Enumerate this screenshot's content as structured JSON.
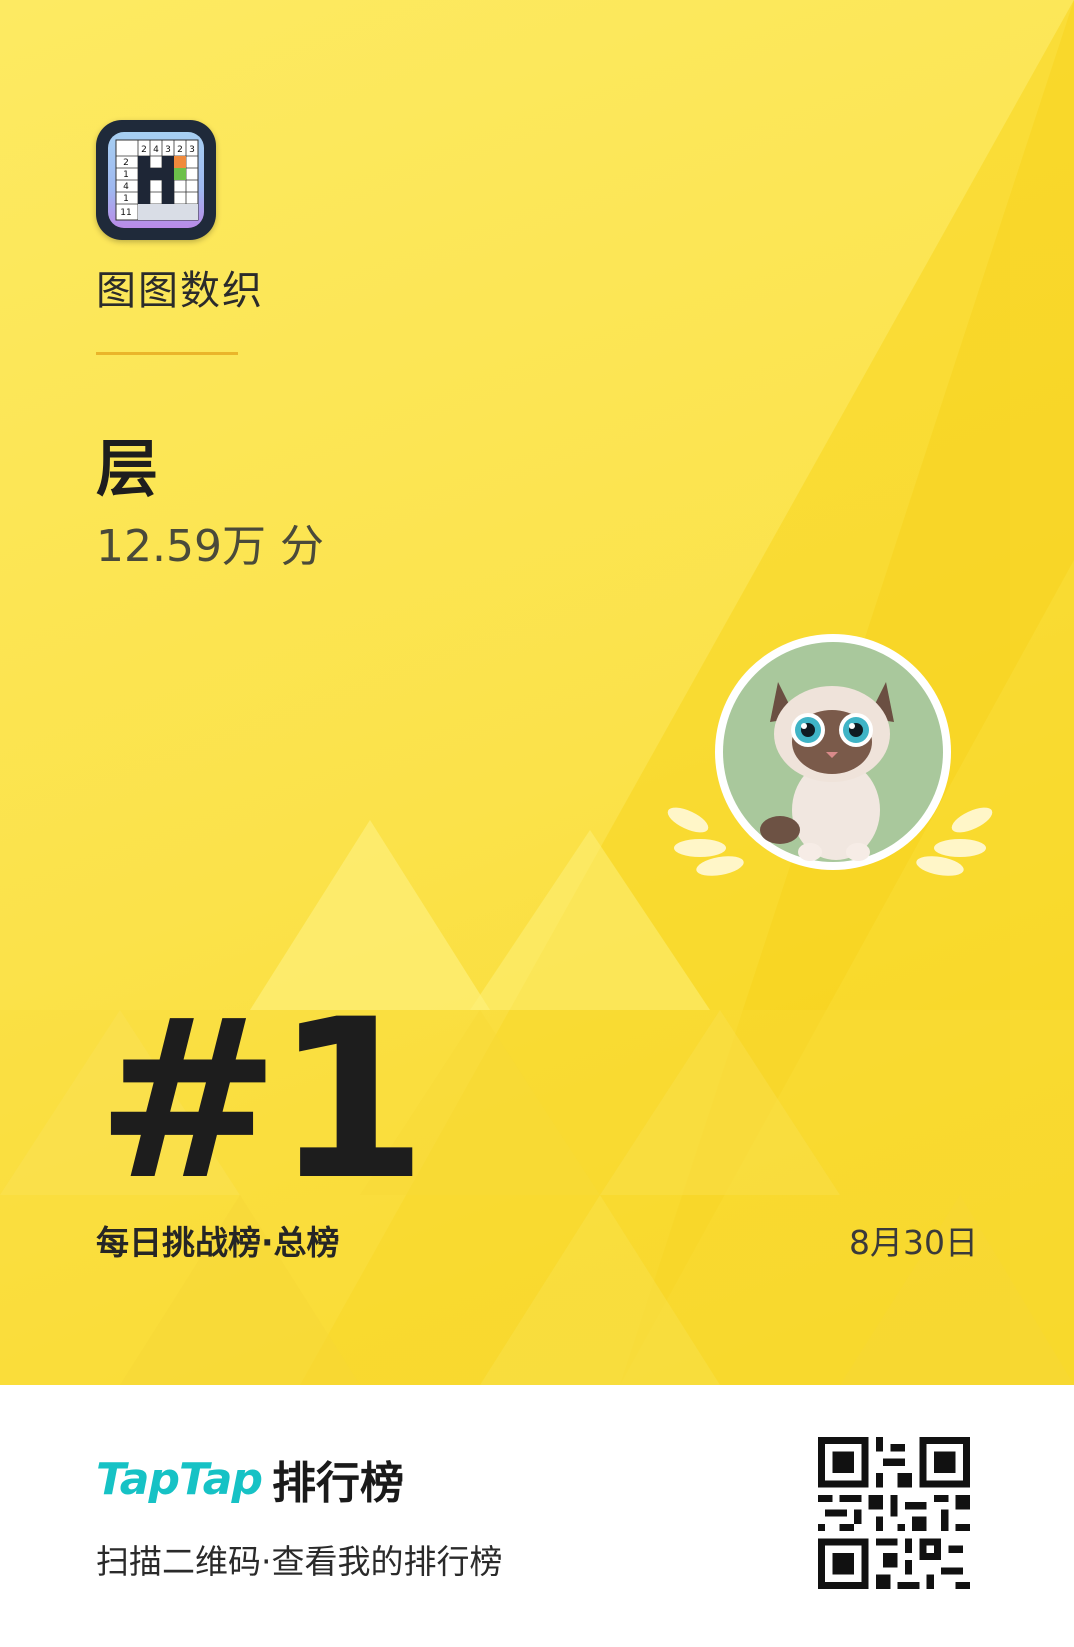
{
  "card": {
    "app_name": "图图数织",
    "player_name": "层",
    "score": "12.59万 分",
    "rank": "#1",
    "board": "每日挑战榜·总榜",
    "date": "8月30日"
  },
  "icon": {
    "clues_top": [
      "2",
      "4",
      "3",
      "2",
      "3"
    ],
    "clues_left": [
      "2",
      "1",
      "4",
      "1",
      "11"
    ]
  },
  "footer": {
    "brand_tap": "TapTap",
    "brand_rank": "排行榜",
    "scan_text": "扫描二维码·查看我的排行榜"
  },
  "colors": {
    "background": "#fbe24a",
    "accent_line": "#eab52a",
    "brand": "#16c2c5",
    "avatar_bg": "#a9c89c"
  }
}
